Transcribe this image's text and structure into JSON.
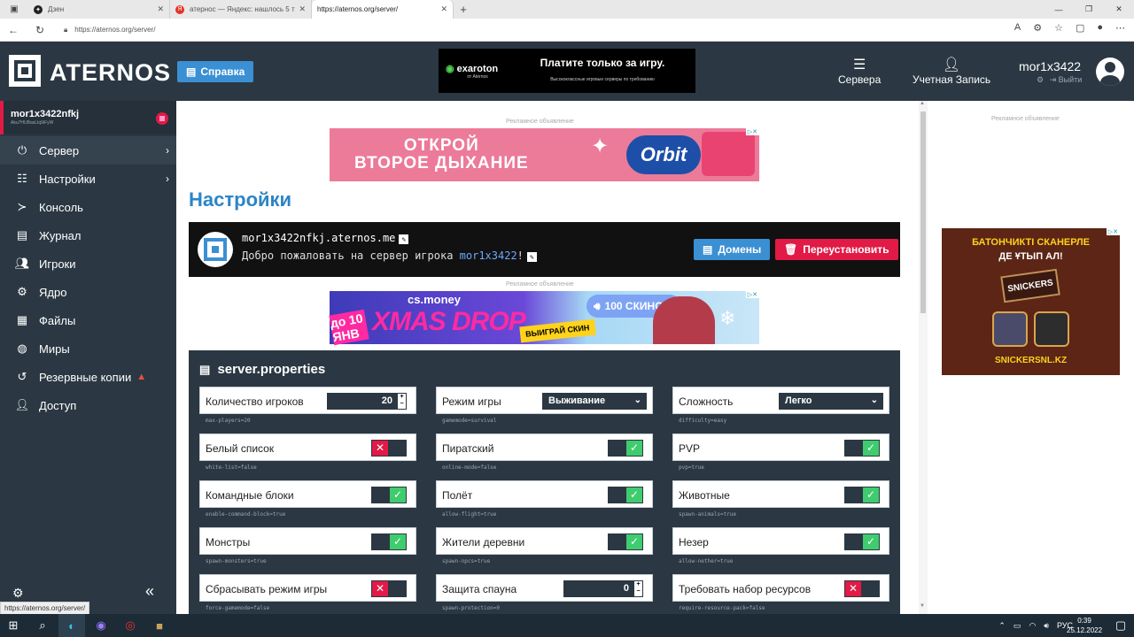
{
  "browser": {
    "tabs": [
      {
        "title": "Дзен",
        "icon_color": "#222222"
      },
      {
        "title": "атернос — Яндекс: нашлось 5 т",
        "icon_color": "#e4332b"
      },
      {
        "title": "https://aternos.org/server/",
        "icon_color": "#ffffff"
      }
    ],
    "url": "https://aternos.org/server/"
  },
  "header": {
    "logo": "ATERNOS",
    "help": "Справка",
    "ad_brand": "exaroton",
    "ad_brand_sub": "от Aternos",
    "ad_title": "Платите только за игру.",
    "ad_sub": "Высококлассные игровые серверы по требованию",
    "nav_servers": "Сервера",
    "nav_account": "Учетная Запись",
    "username": "mor1x3422",
    "exit": "Выйти"
  },
  "sidebar": {
    "server_name": "mor1x3422nfkj",
    "server_id": "Aku7HUBasLIq9iFyW",
    "items": [
      {
        "label": "Сервер",
        "icon": "power-icon"
      },
      {
        "label": "Настройки",
        "icon": "sliders-icon"
      },
      {
        "label": "Консоль",
        "icon": "terminal-icon"
      },
      {
        "label": "Журнал",
        "icon": "file-icon"
      },
      {
        "label": "Игроки",
        "icon": "users-icon"
      },
      {
        "label": "Ядро",
        "icon": "gears-icon"
      },
      {
        "label": "Файлы",
        "icon": "folder-icon"
      },
      {
        "label": "Миры",
        "icon": "globe-icon"
      },
      {
        "label": "Резервные копии",
        "icon": "history-icon"
      },
      {
        "label": "Доступ",
        "icon": "user-lock-icon"
      }
    ],
    "status_url": "https://aternos.org/server/"
  },
  "main": {
    "ad_label": "Рекламное объявление",
    "ad1_line1": "ОТКРОЙ",
    "ad1_line2": "ВТОРОЕ ДЫХАНИЕ",
    "ad1_brand": "Orbit",
    "page_title": "Настройки",
    "server_address": "mor1x3422nfkj.aternos.me",
    "welcome_prefix": "Добро пожаловать на сервер игрока ",
    "welcome_owner": "mor1x3422",
    "welcome_suffix": "!",
    "domains_button": "Домены",
    "reinstall_button": "Переустановить",
    "ad2_brand": "cs.money",
    "ad2_title": "XMAS DROP",
    "ad2_skins": "100 СКИНОВ!",
    "ad2_button": "ВЫИГРАЙ СКИН",
    "ad2_days": "до 10 ЯНВ",
    "props_title": "server.properties",
    "options": [
      {
        "label": "Количество игроков",
        "key": "max-players=20",
        "type": "number",
        "value": "20"
      },
      {
        "label": "Режим игры",
        "key": "gamemode=survival",
        "type": "select",
        "value": "Выживание"
      },
      {
        "label": "Сложность",
        "key": "difficulty=easy",
        "type": "select",
        "value": "Легко"
      },
      {
        "label": "Белый список",
        "key": "white-list=false",
        "type": "toggle",
        "value": "false"
      },
      {
        "label": "Пиратский",
        "key": "online-mode=false",
        "type": "toggle",
        "value": "true"
      },
      {
        "label": "PVP",
        "key": "pvp=true",
        "type": "toggle",
        "value": "true"
      },
      {
        "label": "Командные блоки",
        "key": "enable-command-block=true",
        "type": "toggle",
        "value": "true"
      },
      {
        "label": "Полёт",
        "key": "allow-flight=true",
        "type": "toggle",
        "value": "true"
      },
      {
        "label": "Животные",
        "key": "spawn-animals=true",
        "type": "toggle",
        "value": "true"
      },
      {
        "label": "Монстры",
        "key": "spawn-monsters=true",
        "type": "toggle",
        "value": "true"
      },
      {
        "label": "Жители деревни",
        "key": "spawn-npcs=true",
        "type": "toggle",
        "value": "true"
      },
      {
        "label": "Незер",
        "key": "allow-nether=true",
        "type": "toggle",
        "value": "true"
      },
      {
        "label": "Сбрасывать режим игры",
        "key": "force-gamemode=false",
        "type": "toggle",
        "value": "false"
      },
      {
        "label": "Защита спауна",
        "key": "spawn-protection=0",
        "type": "number",
        "value": "0"
      },
      {
        "label": "Требовать набор ресурсов",
        "key": "require-resource-pack=false",
        "type": "toggle",
        "value": "false"
      }
    ]
  },
  "right_ad": {
    "label": "Рекламное объявление",
    "line1": "БАТОНЧИКТІ СКАНЕРЛЕ",
    "line2": "ДЕ ҰТЫП АЛ!",
    "bar": "SNICKERS",
    "site": "SNICKERSNL.KZ"
  },
  "taskbar": {
    "lang": "РУС",
    "time": "0:39",
    "date": "25.12.2022"
  },
  "colors": {
    "accent": "#3b8fd3",
    "danger": "#e11a46",
    "success": "#3fcc6e",
    "dark": "#2b3843"
  }
}
